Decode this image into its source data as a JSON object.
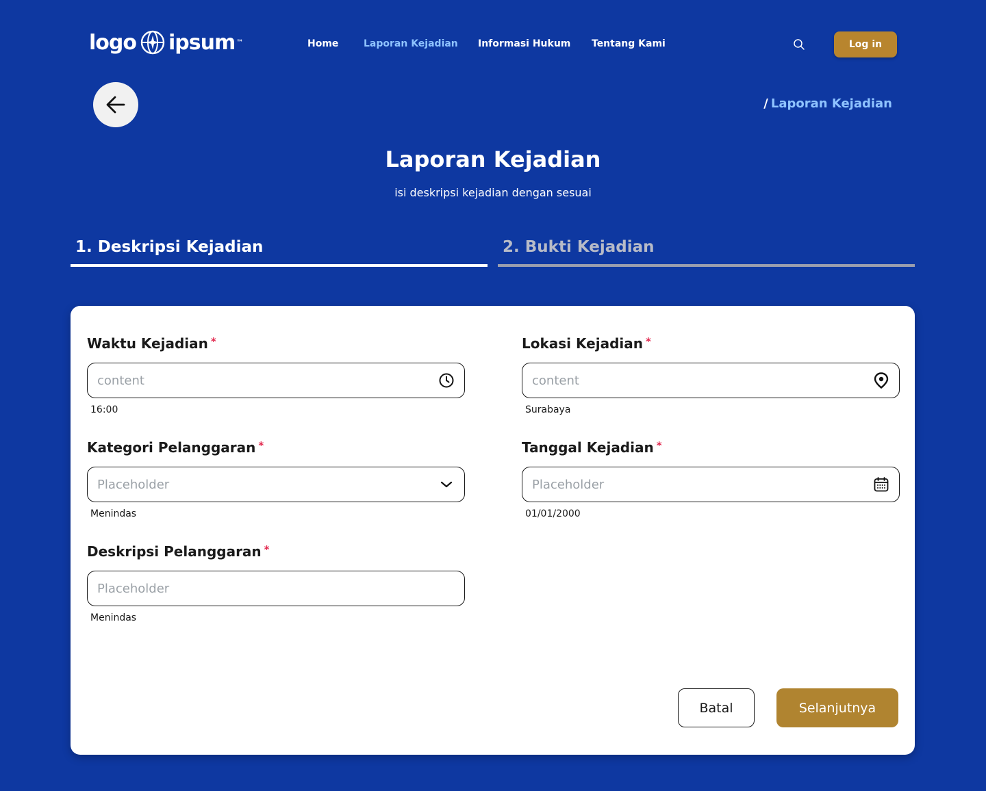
{
  "header": {
    "logo_left": "logo",
    "logo_right": "ipsum",
    "logo_tm": "™",
    "nav": [
      {
        "label": "Home",
        "active": false
      },
      {
        "label": "Laporan Kejadian",
        "active": true
      },
      {
        "label": "Informasi Hukum",
        "active": false
      },
      {
        "label": "Tentang  Kami",
        "active": false
      }
    ],
    "search_icon": "search-icon",
    "login_label": "Log in"
  },
  "breadcrumb": {
    "separator": "/",
    "current": "Laporan Kejadian"
  },
  "page": {
    "title": "Laporan Kejadian",
    "subtitle": "isi deskripsi kejadian dengan sesuai"
  },
  "steps": [
    {
      "label": "1. Deskripsi Kejadian",
      "active": true
    },
    {
      "label": "2. Bukti Kejadian",
      "active": false
    }
  ],
  "form": {
    "required_mark": "*",
    "waktu": {
      "label": "Waktu Kejadian",
      "placeholder": "content",
      "helper": "16:00",
      "icon": "clock-icon"
    },
    "lokasi": {
      "label": "Lokasi Kejadian",
      "placeholder": "content",
      "helper": "Surabaya",
      "icon": "location-pin-icon"
    },
    "kategori": {
      "label": "Kategori Pelanggaran",
      "placeholder": "Placeholder",
      "helper": "Menindas",
      "icon": "chevron-down-icon"
    },
    "tanggal": {
      "label": "Tanggal Kejadian",
      "placeholder": "Placeholder",
      "helper": "01/01/2000",
      "icon": "calendar-icon"
    },
    "deskripsi": {
      "label": "Deskripsi Pelanggaran",
      "placeholder": "Placeholder",
      "helper": "Menindas"
    }
  },
  "actions": {
    "cancel_label": "Batal",
    "next_label": "Selanjutnya"
  },
  "colors": {
    "background": "#0E38A1",
    "accent_gold": "#B8852E",
    "active_link": "#8FC3FF",
    "required": "#E2284E"
  }
}
